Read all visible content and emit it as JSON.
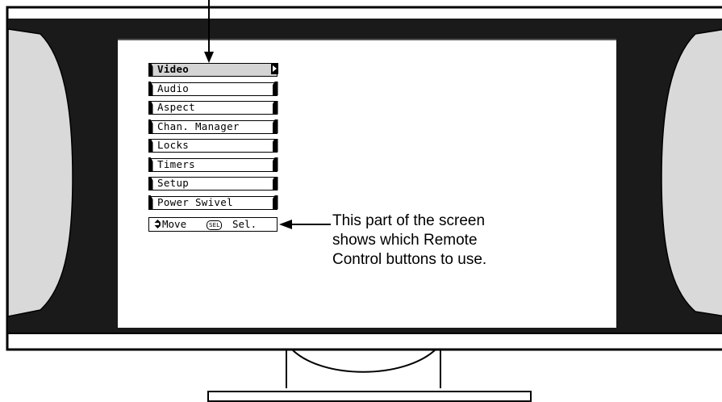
{
  "menu": {
    "items": [
      {
        "label": "Video",
        "selected": true
      },
      {
        "label": "Audio",
        "selected": false
      },
      {
        "label": "Aspect",
        "selected": false
      },
      {
        "label": "Chan. Manager",
        "selected": false
      },
      {
        "label": "Locks",
        "selected": false
      },
      {
        "label": "Timers",
        "selected": false
      },
      {
        "label": "Setup",
        "selected": false
      },
      {
        "label": "Power Swivel",
        "selected": false
      }
    ]
  },
  "help_bar": {
    "move_icon": "up-down-arrow-icon",
    "move_label": "Move",
    "sel_button": "SEL",
    "sel_label": "Sel."
  },
  "callout": {
    "lines": [
      "This part of the screen",
      "shows which Remote",
      "Control buttons to use."
    ]
  },
  "colors": {
    "bezel": "#1a1a1a",
    "side_panel": "#d9d9d9",
    "screen": "#ffffff",
    "selected_item": "#d4d4d4"
  }
}
